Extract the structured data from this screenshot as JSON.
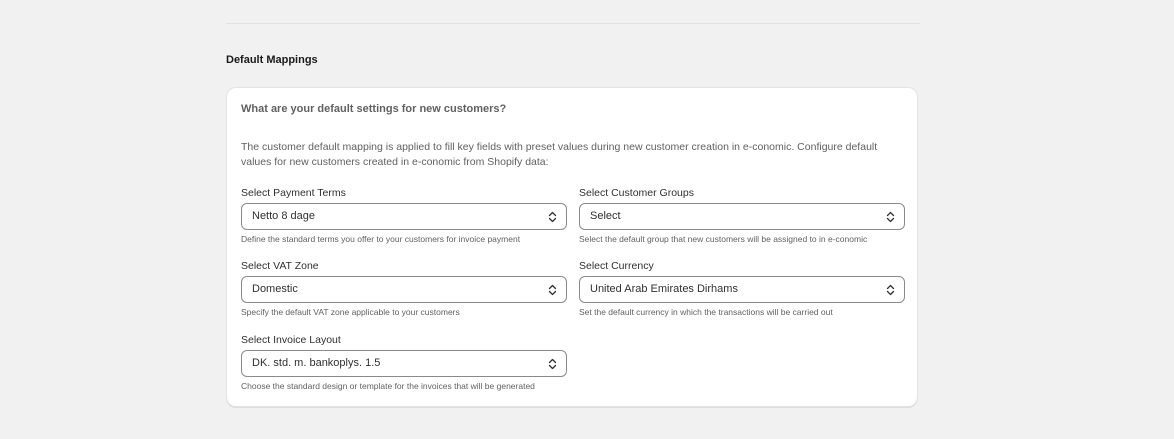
{
  "section": {
    "title": "Default Mappings"
  },
  "card": {
    "question": "What are your default settings for new customers?",
    "description": "The customer default mapping is applied to fill key fields with preset values during new customer creation in e-conomic. Configure default values for new customers created in e-conomic from Shopify data:"
  },
  "fields": {
    "payment_terms": {
      "label": "Select Payment Terms",
      "value": "Netto 8 dage",
      "help": "Define the standard terms you offer to your customers for invoice payment"
    },
    "customer_groups": {
      "label": "Select Customer Groups",
      "value": "Select",
      "help": "Select the default group that new customers will be assigned to in e-conomic"
    },
    "vat_zone": {
      "label": "Select VAT Zone",
      "value": "Domestic",
      "help": "Specify the default VAT zone applicable to your customers"
    },
    "currency": {
      "label": "Select Currency",
      "value": "United Arab Emirates Dirhams",
      "help": "Set the default currency in which the transactions will be carried out"
    },
    "invoice_layout": {
      "label": "Select Invoice Layout",
      "value": "DK. std. m. bankoplys. 1.5",
      "help": "Choose the standard design or template for the invoices that will be generated"
    }
  },
  "icons": {
    "select_caret": "chevron-up-down-icon"
  }
}
